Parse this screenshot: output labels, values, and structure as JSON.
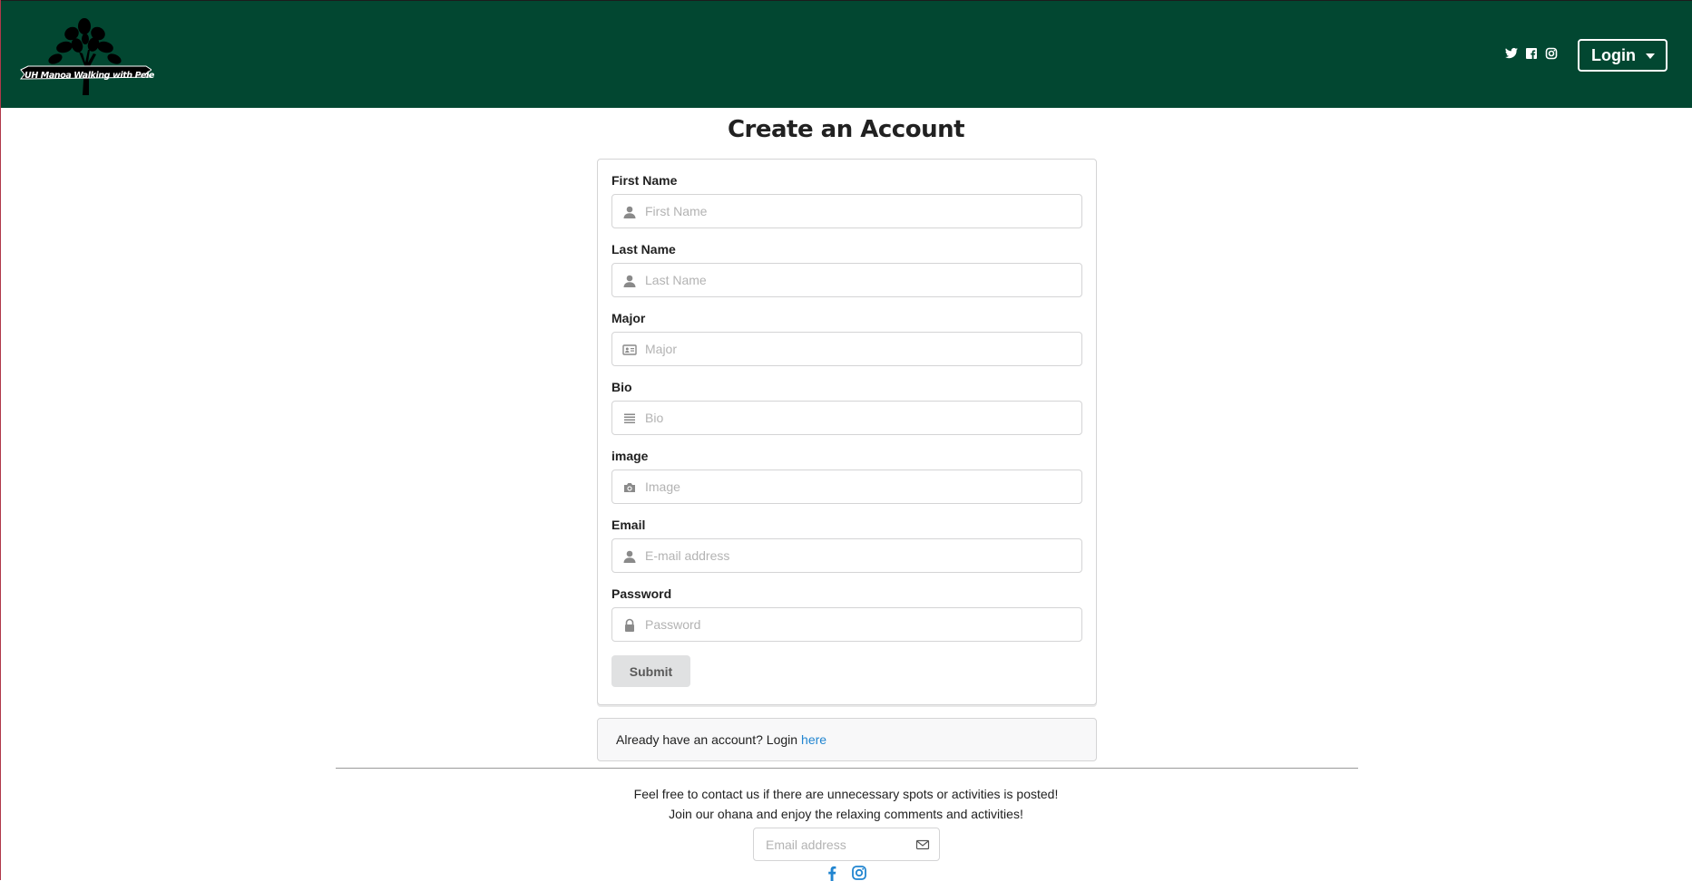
{
  "header": {
    "logo_text": "UH Manoa Walking with Pele",
    "login_label": "Login",
    "social_icons": [
      "twitter-icon",
      "facebook-icon",
      "instagram-icon"
    ],
    "background_color": "#024731"
  },
  "page": {
    "title": "Create an Account"
  },
  "form": {
    "fields": [
      {
        "label": "First Name",
        "placeholder": "First Name",
        "icon": "user-icon"
      },
      {
        "label": "Last Name",
        "placeholder": "Last Name",
        "icon": "user-icon"
      },
      {
        "label": "Major",
        "placeholder": "Major",
        "icon": "id-card-icon"
      },
      {
        "label": "Bio",
        "placeholder": "Bio",
        "icon": "align-justify-icon"
      },
      {
        "label": "image",
        "placeholder": "Image",
        "icon": "camera-icon"
      },
      {
        "label": "Email",
        "placeholder": "E-mail address",
        "icon": "user-icon"
      },
      {
        "label": "Password",
        "placeholder": "Password",
        "icon": "lock-icon"
      }
    ],
    "submit_label": "Submit"
  },
  "login_prompt": {
    "text": "Already have an account? Login",
    "link_text": "here",
    "link_color": "#2185d0"
  },
  "footer": {
    "line1": "Feel free to contact us if there are unnecessary spots or activities is posted!",
    "line2": "Join our ohana and enjoy the relaxing comments and activities!",
    "email_placeholder": "Email address",
    "social_icons": [
      "facebook-icon",
      "instagram-icon"
    ]
  }
}
